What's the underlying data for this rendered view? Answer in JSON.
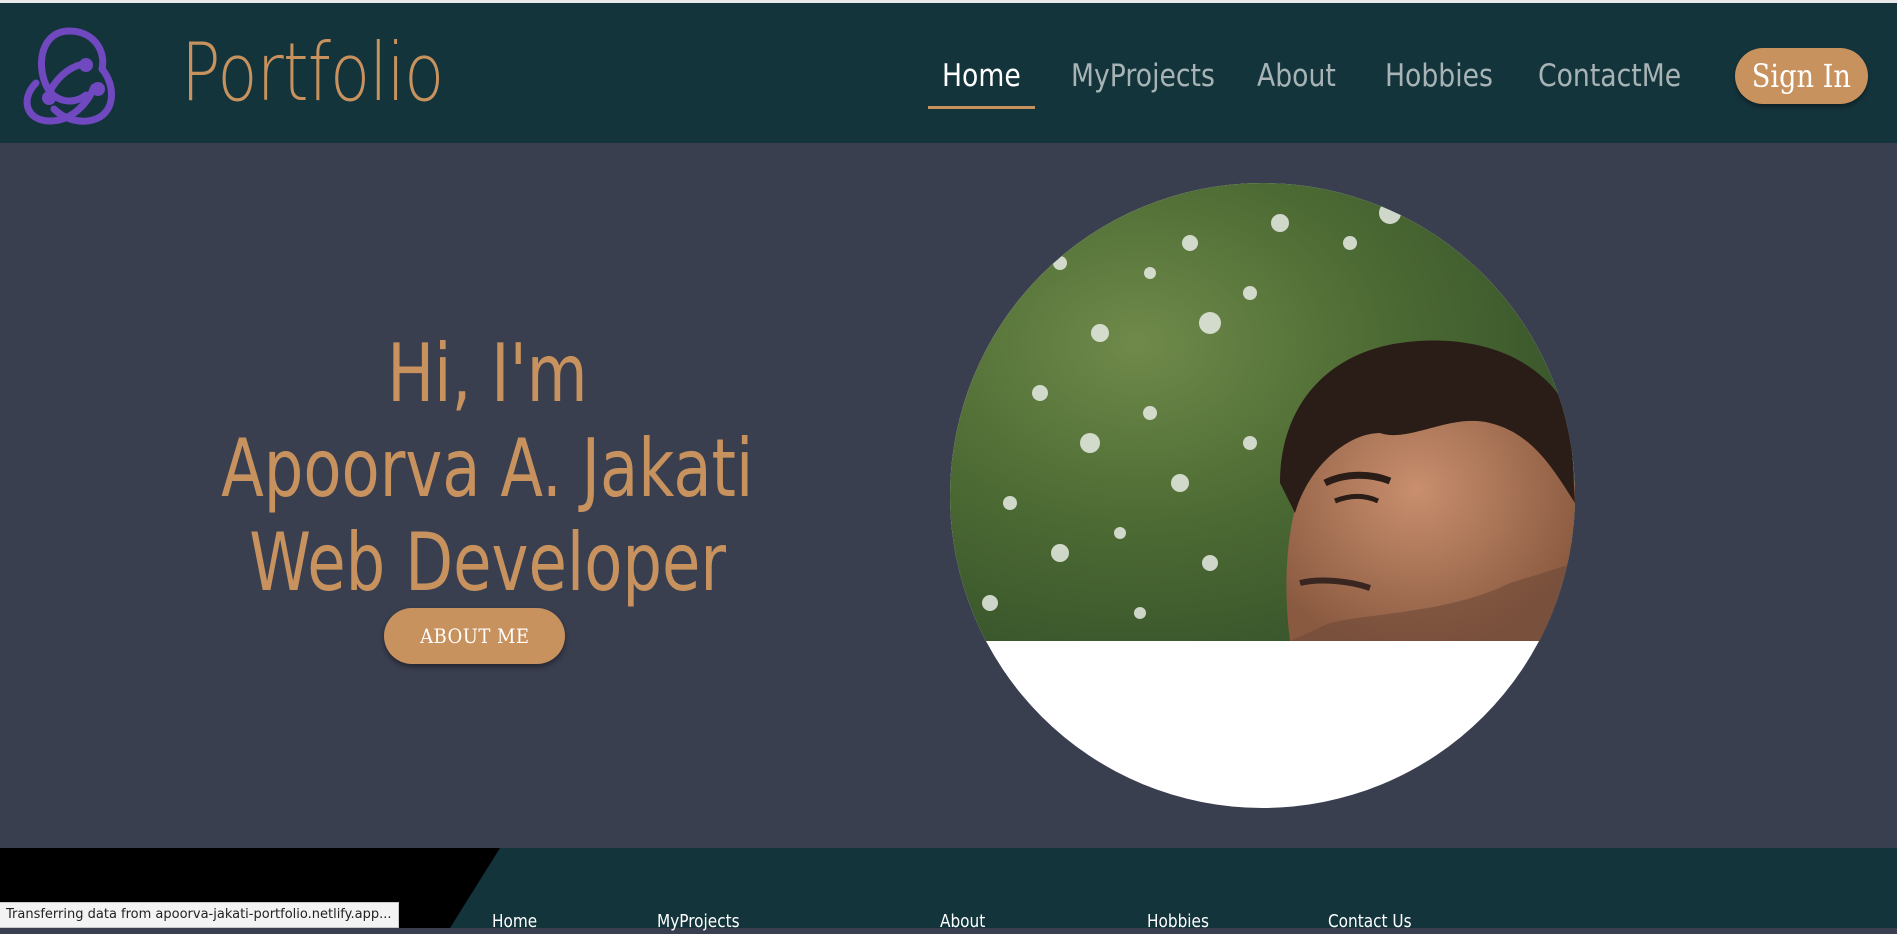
{
  "header": {
    "brand": "Portfolio",
    "logo_icon": "redux-logo-icon",
    "nav": [
      {
        "label": "Home",
        "active": true
      },
      {
        "label": "MyProjects",
        "active": false
      },
      {
        "label": "About",
        "active": false
      },
      {
        "label": "Hobbies",
        "active": false
      },
      {
        "label": "ContactMe",
        "active": false
      }
    ],
    "signin_label": "Sign In"
  },
  "hero": {
    "greeting": "Hi, I'm",
    "name": "Apoorva A. Jakati",
    "role": "Web Developer",
    "button_label": "ABOUT ME",
    "photo": "profile-photo"
  },
  "footer": {
    "links": [
      "Home",
      "MyProjects",
      "About",
      "Hobbies",
      "Contact Us"
    ]
  },
  "status": "Transferring data from apoorva-jakati-portfolio.netlify.app...",
  "colors": {
    "header_bg": "#14343c",
    "page_bg": "#3a3f50",
    "accent": "#c8925e",
    "logo": "#7048c0"
  }
}
